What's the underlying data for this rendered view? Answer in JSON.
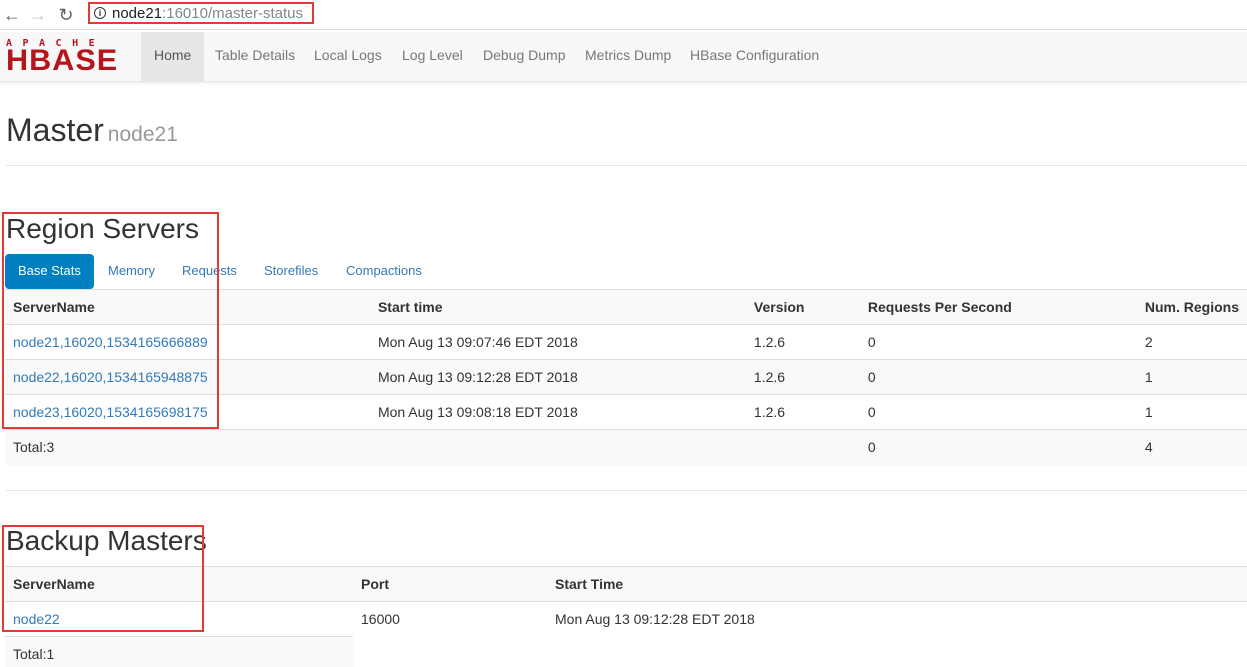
{
  "browser": {
    "url_host": "node21",
    "url_path": ":16010/master-status"
  },
  "logo": {
    "top_text": "APACHE",
    "brand": "HBASE"
  },
  "nav": {
    "items": [
      {
        "label": "Home"
      },
      {
        "label": "Table Details"
      },
      {
        "label": "Local Logs"
      },
      {
        "label": "Log Level"
      },
      {
        "label": "Debug Dump"
      },
      {
        "label": "Metrics Dump"
      },
      {
        "label": "HBase Configuration"
      }
    ]
  },
  "page": {
    "title": "Master",
    "subtitle": "node21"
  },
  "region_servers": {
    "title": "Region Servers",
    "tabs": [
      {
        "label": "Base Stats"
      },
      {
        "label": "Memory"
      },
      {
        "label": "Requests"
      },
      {
        "label": "Storefiles"
      },
      {
        "label": "Compactions"
      }
    ],
    "columns": [
      "ServerName",
      "Start time",
      "Version",
      "Requests Per Second",
      "Num. Regions"
    ],
    "rows": [
      {
        "server": "node21,16020,1534165666889",
        "start": "Mon Aug 13 09:07:46 EDT 2018",
        "version": "1.2.6",
        "rps": "0",
        "regions": "2"
      },
      {
        "server": "node22,16020,1534165948875",
        "start": "Mon Aug 13 09:12:28 EDT 2018",
        "version": "1.2.6",
        "rps": "0",
        "regions": "1"
      },
      {
        "server": "node23,16020,1534165698175",
        "start": "Mon Aug 13 09:08:18 EDT 2018",
        "version": "1.2.6",
        "rps": "0",
        "regions": "1"
      }
    ],
    "total": {
      "label": "Total:3",
      "rps": "0",
      "regions": "4"
    }
  },
  "backup_masters": {
    "title": "Backup Masters",
    "columns": [
      "ServerName",
      "Port",
      "Start Time"
    ],
    "rows": [
      {
        "server": "node22",
        "port": "16000",
        "start": "Mon Aug 13 09:12:28 EDT 2018"
      }
    ],
    "total": {
      "label": "Total:1"
    }
  },
  "colors": {
    "accent": "#0080c0",
    "link": "#337ab7",
    "brand": "#b5151b",
    "highlight": "#e53935"
  }
}
